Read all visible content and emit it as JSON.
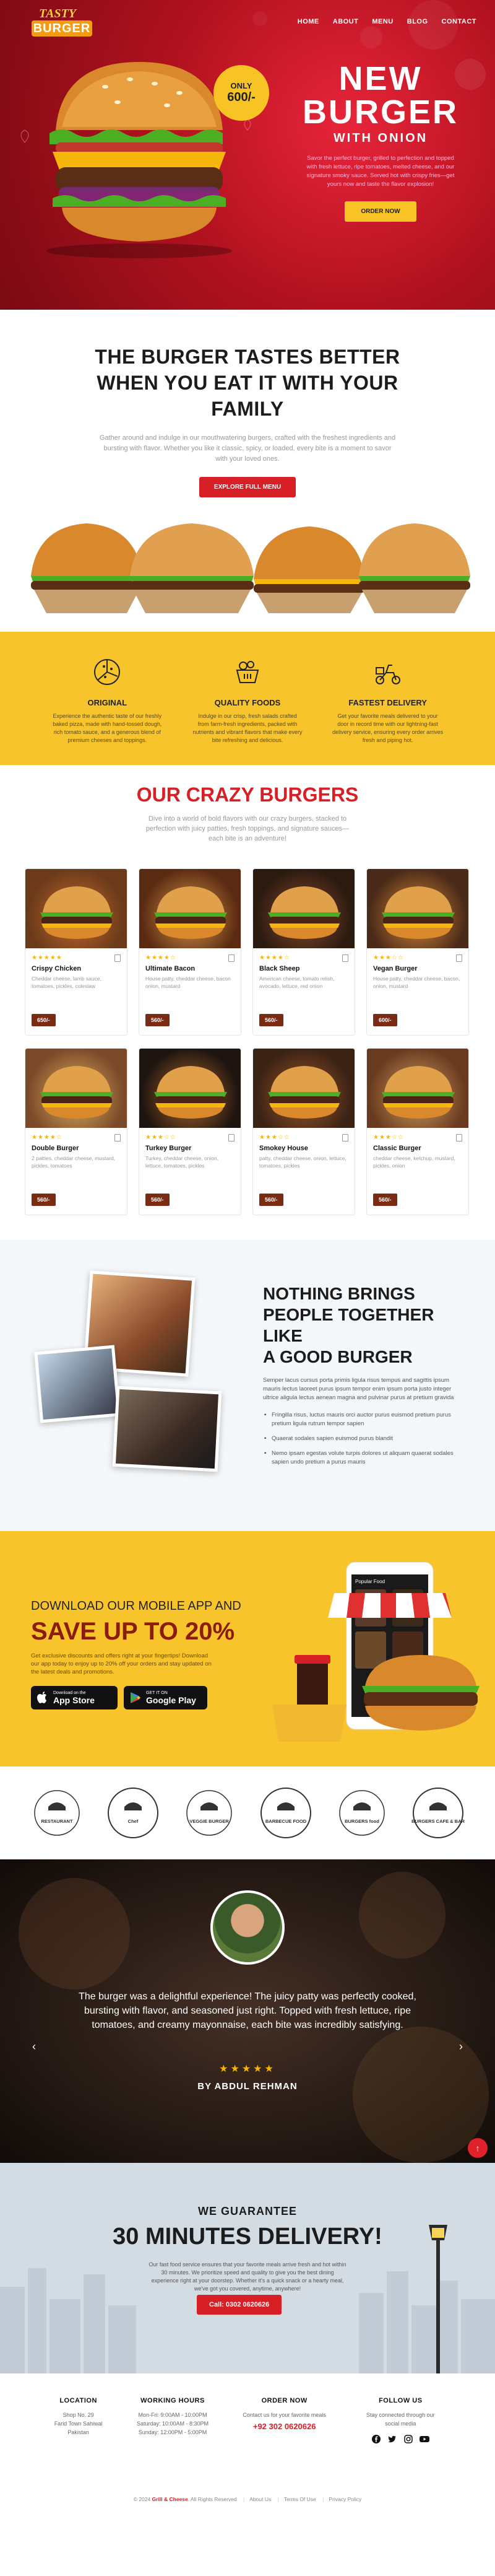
{
  "colors": {
    "brand_red": "#d71f26",
    "brand_yellow": "#f8c42b",
    "price_brown": "#7a2b12"
  },
  "nav": {
    "logo_top": "TASTY",
    "logo_bottom": "BURGER",
    "items": [
      "HOME",
      "ABOUT",
      "MENU",
      "BLOG",
      "CONTACT"
    ]
  },
  "hero": {
    "badge_top": "ONLY",
    "badge_price": "600/-",
    "title_line1": "NEW",
    "title_line2": "BURGER",
    "subtitle": "WITH ONION",
    "desc": "Savor the perfect burger, grilled to perfection and topped with fresh lettuce, ripe tomatoes, melted cheese, and our signature smoky sauce. Served hot with crispy fries—get yours now and taste the flavor explosion!",
    "button": "ORDER NOW"
  },
  "tastes": {
    "title_line1": "THE BURGER TASTES BETTER",
    "title_line2": "WHEN YOU EAT IT WITH YOUR",
    "title_line3": "FAMILY",
    "desc": "Gather around and indulge in our mouthwatering burgers, crafted with the freshest ingredients and bursting with flavor. Whether you like it classic, spicy, or loaded, every bite is a moment to savor with your loved ones.",
    "button": "EXPLORE FULL MENU"
  },
  "features": [
    {
      "icon": "pizza-icon",
      "title": "ORIGINAL",
      "desc": "Experience the authentic taste of our freshly baked pizza, made with hand-tossed dough, rich tomato sauce, and a generous blend of premium cheeses and toppings."
    },
    {
      "icon": "food-basket-icon",
      "title": "QUALITY FOODS",
      "desc": "Indulge in our crisp, fresh salads crafted from farm-fresh ingredients, packed with nutrients and vibrant flavors that make every bite refreshing and delicious."
    },
    {
      "icon": "delivery-scooter-icon",
      "title": "FASTEST DELIVERY",
      "desc": "Get your favorite meals delivered to your door in record time with our lightning-fast delivery service, ensuring every order arrives fresh and piping hot."
    }
  ],
  "crazy": {
    "title": "OUR CRAZY BURGERS",
    "desc": "Dive into a world of bold flavors with our crazy burgers, stacked to perfection with juicy patties, fresh toppings, and signature sauces—each bite is an adventure!",
    "items": [
      {
        "name": "Crispy Chicken",
        "desc": "Cheddar cheese, lamb sauce, tomatoes, pickles, coleslaw",
        "price": "650/-",
        "rating": 5
      },
      {
        "name": "Ultimate Bacon",
        "desc": "House patty, cheddar cheese, bacon onion, mustard",
        "price": "560/-",
        "rating": 4
      },
      {
        "name": "Black Sheep",
        "desc": "American cheese, tomato relish, avocado, lettuce, red onion",
        "price": "560/-",
        "rating": 4
      },
      {
        "name": "Vegan Burger",
        "desc": "House patty, cheddar cheese, bacon, onion, mustard",
        "price": "600/-",
        "rating": 3
      },
      {
        "name": "Double Burger",
        "desc": "2 patties, cheddar cheese, mustard, pickles, tomatoes",
        "price": "560/-",
        "rating": 4
      },
      {
        "name": "Turkey Burger",
        "desc": "Turkey, cheddar cheese, onion, lettuce, tomatoes, pickles",
        "price": "560/-",
        "rating": 3
      },
      {
        "name": "Smokey House",
        "desc": "patty, cheddar cheese, onion, lettuce, tomatoes, pickles",
        "price": "560/-",
        "rating": 3
      },
      {
        "name": "Classic Burger",
        "desc": "cheddar cheese, ketchup, mustard, pickles, onion",
        "price": "560/-",
        "rating": 3
      }
    ]
  },
  "together": {
    "title_line1": "NOTHING BRINGS",
    "title_line2": "PEOPLE TOGETHER LIKE",
    "title_line3": "A GOOD BURGER",
    "desc": "Semper lacus cursus porta primis ligula risus tempus and sagittis ipsum mauris lectus laoreet purus ipsum tempor enim ipsum porta justo integer ultrice aligula lectus aenean magna and pulvinar purus at pretium gravida",
    "bullets": [
      "Fringilla risus, luctus mauris orci auctor purus euismod pretium purus pretium ligula rutrum tempor sapien",
      "Quaerat sodales sapien euismod purus blandit",
      "Nemo ipsam egestas volute turpis dolores ut aliquam quaerat sodales sapien undo pretium a purus mauris"
    ]
  },
  "app": {
    "line1": "DOWNLOAD OUR MOBILE APP AND",
    "line2": "SAVE UP TO 20%",
    "desc": "Get exclusive discounts and offers right at your fingertips! Download our app today to enjoy up to 20% off your orders and stay updated on the latest deals and promotions.",
    "appstore_small": "Download on the",
    "appstore_big": "App Store",
    "play_small": "GET IT ON",
    "play_big": "Google Play",
    "phone_label": "Popular Food"
  },
  "logos": [
    {
      "name": "chef-restaurant-logo-icon",
      "text": "RESTAURANT"
    },
    {
      "name": "chef-script-logo-icon",
      "text": "Chef"
    },
    {
      "name": "veggie-burger-logo-icon",
      "text": "VEGGIE BURGER"
    },
    {
      "name": "barbecue-food-logo-icon",
      "text": "BARBECUE FOOD"
    },
    {
      "name": "burgers-food-logo-icon",
      "text": "BURGERS food"
    },
    {
      "name": "burgers-cafe-bar-logo-icon",
      "text": "BURGERS CAFE & BAR"
    }
  ],
  "testimonial": {
    "quote": "The burger was a delightful experience! The juicy patty was perfectly cooked, bursting with flavor, and seasoned just right. Topped with fresh lettuce, ripe tomatoes, and creamy mayonnaise, each bite was incredibly satisfying.",
    "stars": "★★★★★",
    "author": "BY ABDUL REHMAN"
  },
  "guarantee": {
    "line1": "WE GUARANTEE",
    "line2": "30 MINUTES DELIVERY!",
    "desc": "Our fast food service ensures that your favorite meals arrive fresh and hot within 30 minutes. We prioritize speed and quality to give you the best dining experience right at your doorstep. Whether it's a quick snack or a hearty meal, we've got you covered, anytime, anywhere!",
    "button": "Call: 0302 0620626"
  },
  "footer": {
    "location": {
      "title": "LOCATION",
      "lines": [
        "Shop No. 29",
        "Farid Town Sahiwal",
        "Pakistan"
      ]
    },
    "hours": {
      "title": "WORKING HOURS",
      "lines": [
        "Mon-Fri: 9:00AM - 10:00PM",
        "Saturday: 10:00AM - 8:30PM",
        "Sunday: 12:00PM - 5:00PM"
      ]
    },
    "order": {
      "title": "ORDER NOW",
      "lines": [
        "Contact us for your favorite meals"
      ],
      "phone": "+92 302 0620626"
    },
    "follow": {
      "title": "FOLLOW US",
      "lines": [
        "Stay connected through our social media"
      ]
    },
    "copy_prefix": "© 2024",
    "copy_brand": "Grill & Cheese",
    "copy_suffix": ". All Rights Reserved",
    "links": [
      "About Us",
      "Terms Of Use",
      "Privacy Policy"
    ]
  }
}
